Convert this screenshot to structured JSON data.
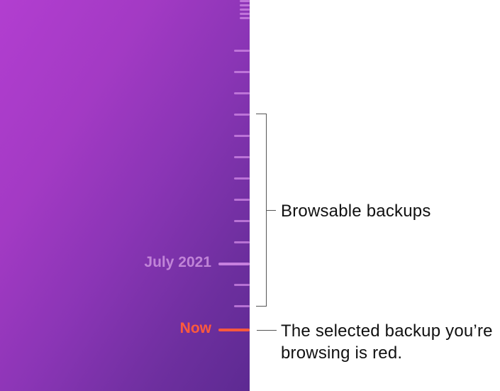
{
  "timeline": {
    "month_label": "July 2021",
    "now_label": "Now"
  },
  "annotations": {
    "browsable": "Browsable backups",
    "selected": "The selected backup you’re browsing is red."
  }
}
